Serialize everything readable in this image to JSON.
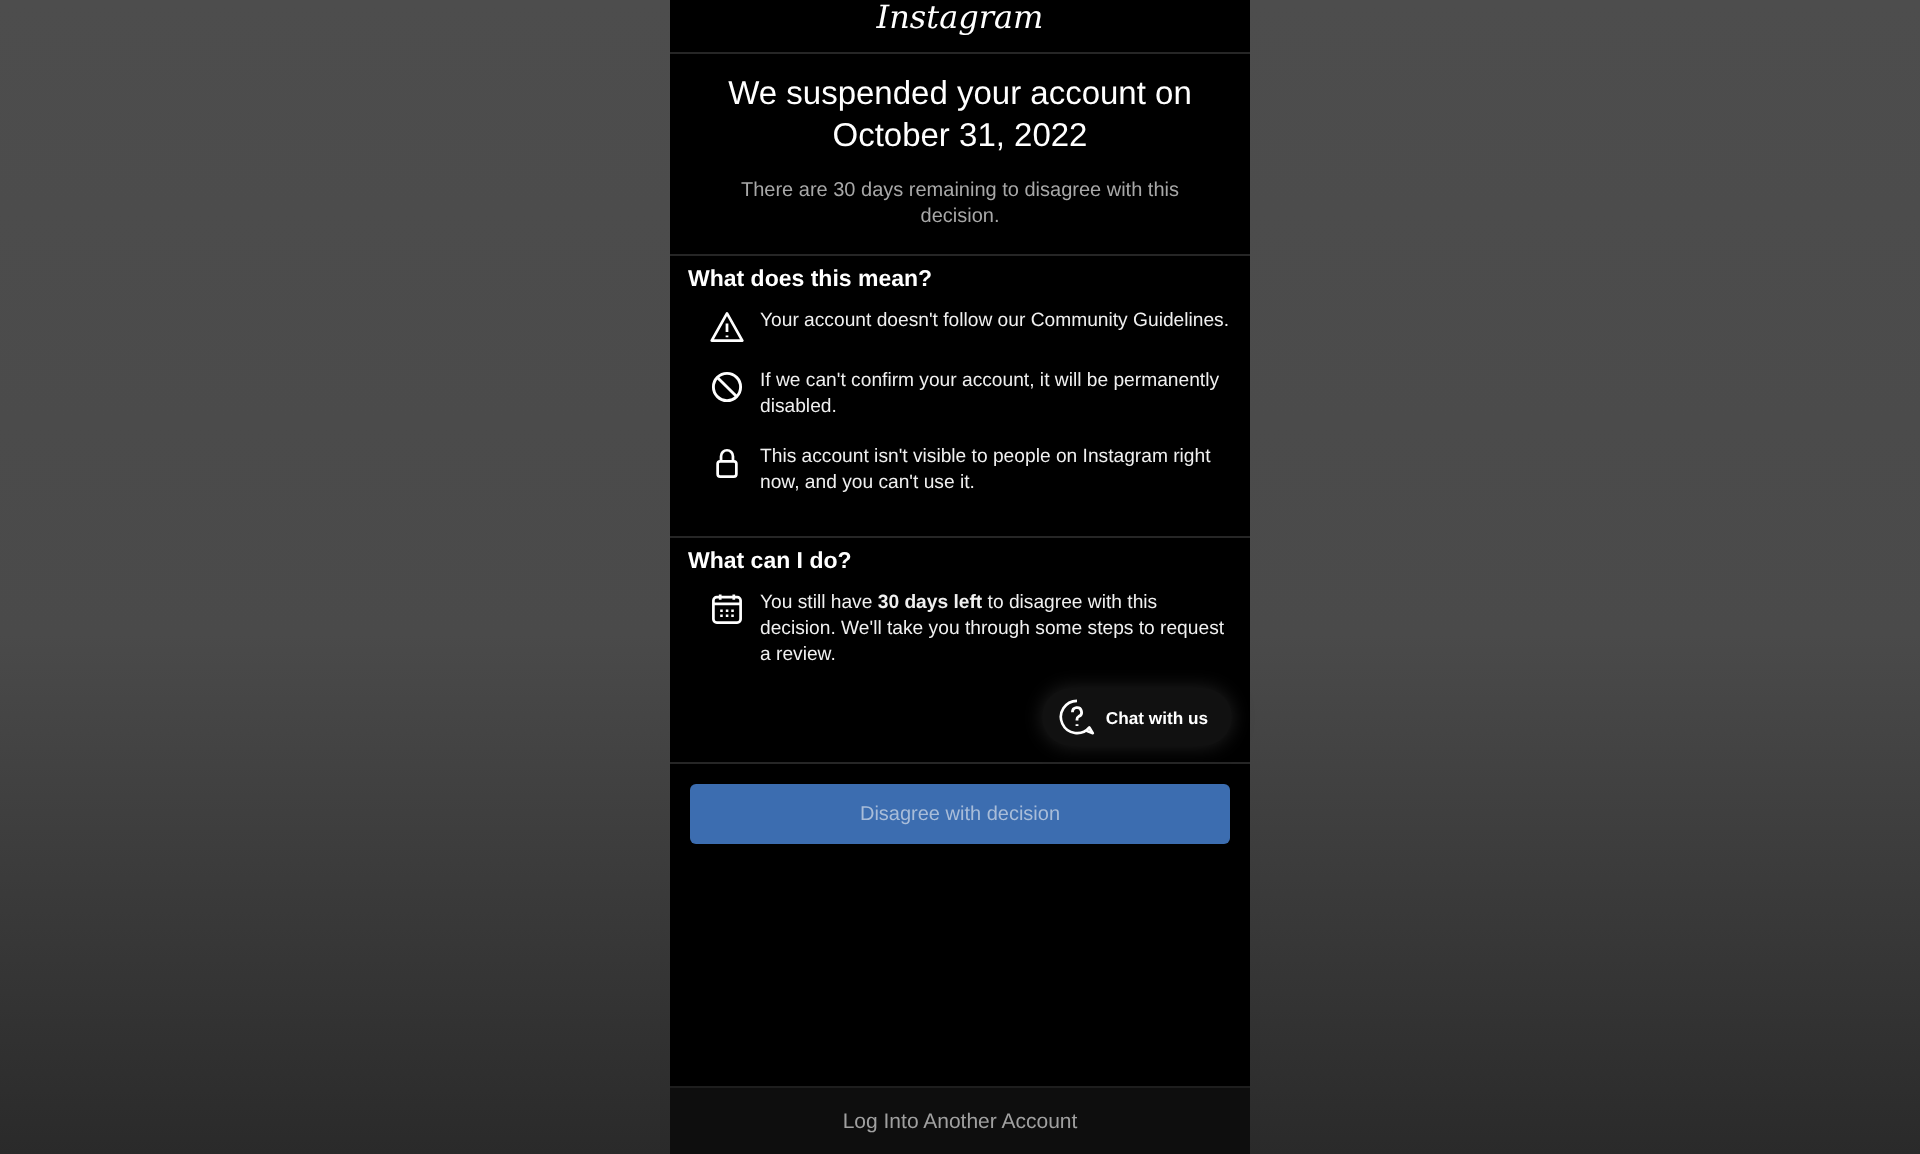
{
  "header": {
    "logo": "Instagram"
  },
  "title": "We suspended your account on October 31, 2022",
  "subtitle": "There are 30 days remaining to disagree with this decision.",
  "sections": [
    {
      "heading": "What does this mean?",
      "items": [
        {
          "kind": "warning",
          "text": "Your account doesn't follow our Community Guidelines."
        },
        {
          "kind": "blocked",
          "text": "If we can't confirm your account, it will be permanently disabled."
        },
        {
          "kind": "lock",
          "text": "This account isn't visible to people on Instagram right now, and you can't use it."
        }
      ]
    },
    {
      "heading": "What can I do?",
      "items": [
        {
          "kind": "calendar",
          "text": "You still have **30 days left** to disagree with this decision. We'll take you through some steps to request a review."
        }
      ]
    }
  ],
  "chat_button": "Chat with us",
  "primary_button": "Disagree with decision",
  "footer_link": "Log Into Another Account"
}
